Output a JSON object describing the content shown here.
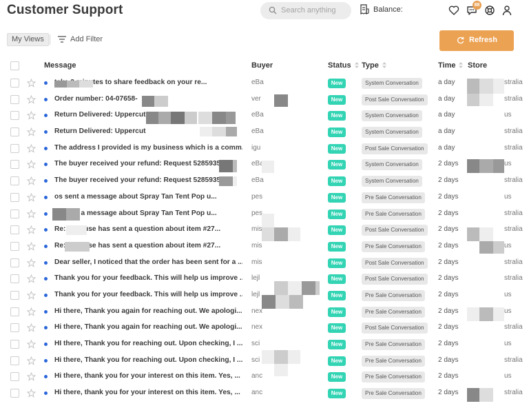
{
  "header": {
    "title": "Customer Support",
    "search_placeholder": "Search anything",
    "balance_label": "Balance:",
    "notification_count": "88",
    "accent_color": "#eca253"
  },
  "toolbar": {
    "views_label": "My Views",
    "filter_label": "Add Filter",
    "refresh_label": "Refresh"
  },
  "columns": {
    "message": "Message",
    "buyer": "Buyer",
    "status": "Status",
    "type": "Type",
    "time": "Time",
    "store": "Store"
  },
  "rows": [
    {
      "message": "take 3 minutes to share feedback on your re...",
      "buyer": "eBa",
      "status": "New",
      "type": "System Conversation",
      "time": "a day",
      "store": "stralia"
    },
    {
      "message": "Order number: 04-07658-",
      "buyer": "ver",
      "status": "New",
      "type": "Post Sale Conversation",
      "time": "a day",
      "store": "stralia"
    },
    {
      "message": "Return Delivered: Uppercut",
      "buyer": "eBa",
      "status": "New",
      "type": "System Conversation",
      "time": "a day",
      "store": "us"
    },
    {
      "message": "Return Delivered: Uppercut",
      "buyer": "eBa",
      "status": "New",
      "type": "System Conversation",
      "time": "a day",
      "store": "stralia"
    },
    {
      "message": "The address I provided is my business which is a comm...",
      "buyer": "igu",
      "status": "New",
      "type": "Post Sale Conversation",
      "time": "a day",
      "store": "stralia"
    },
    {
      "message": "The buyer received your refund: Request 5285935",
      "buyer": "eBa",
      "status": "New",
      "type": "System Conversation",
      "time": "2 days",
      "store": "us"
    },
    {
      "message": "The buyer received your refund: Request 5285935",
      "buyer": "eBa",
      "status": "New",
      "type": "System Conversation",
      "time": "2 days",
      "store": "stralia"
    },
    {
      "message": "os sent a message about Spray Tan Tent Pop u...",
      "buyer": "pes",
      "status": "New",
      "type": "Pre Sale Conversation",
      "time": "2 days",
      "store": "us"
    },
    {
      "message": "os sent a message about Spray Tan Tent Pop u...",
      "buyer": "pes",
      "status": "New",
      "type": "Pre Sale Conversation",
      "time": "2 days",
      "store": "stralia"
    },
    {
      "message": "Re: yshouse has sent a question about item #27...",
      "buyer": "mis",
      "status": "New",
      "type": "Post Sale Conversation",
      "time": "2 days",
      "store": "stralia"
    },
    {
      "message": "Re: yshouse has sent a question about item #27...",
      "buyer": "mis",
      "status": "New",
      "type": "Pre Sale Conversation",
      "time": "2 days",
      "store": "us"
    },
    {
      "message": "Dear seller, I noticed that the order has been sent for a ...",
      "buyer": "mis",
      "status": "New",
      "type": "Post Sale Conversation",
      "time": "2 days",
      "store": "stralia"
    },
    {
      "message": "Thank you for your feedback. This will help us improve ...",
      "buyer": "lejl",
      "status": "New",
      "type": "Post Sale Conversation",
      "time": "2 days",
      "store": "stralia"
    },
    {
      "message": "Thank you for your feedback. This will help us improve ...",
      "buyer": "lejl",
      "status": "New",
      "type": "Pre Sale Conversation",
      "time": "2 days",
      "store": "us"
    },
    {
      "message": "Hi there,  Thank you again for reaching out. We apologi...",
      "buyer": "nex",
      "status": "New",
      "type": "Pre Sale Conversation",
      "time": "2 days",
      "store": "us"
    },
    {
      "message": "Hi there,  Thank you again for reaching out. We apologi...",
      "buyer": "nex",
      "status": "New",
      "type": "Post Sale Conversation",
      "time": "2 days",
      "store": "stralia"
    },
    {
      "message": "HI there,  Thank you for reaching out. Upon checking, I ...",
      "buyer": "sci",
      "status": "New",
      "type": "Pre Sale Conversation",
      "time": "2 days",
      "store": "us"
    },
    {
      "message": "Hi there,  Thank you for reaching out. Upon checking, I ...",
      "buyer": "sci",
      "status": "New",
      "type": "Pre Sale Conversation",
      "time": "2 days",
      "store": "stralia"
    },
    {
      "message": "Hi there,  thank you for your interest on this item. Yes, ...",
      "buyer": "anc",
      "status": "New",
      "type": "Pre Sale Conversation",
      "time": "2 days",
      "store": "us"
    },
    {
      "message": "Hi there,  thank you for your interest on this item. Yes, ...",
      "buyer": "anc",
      "status": "New",
      "type": "Pre Sale Conversation",
      "time": "2 days",
      "store": "stralia"
    }
  ]
}
